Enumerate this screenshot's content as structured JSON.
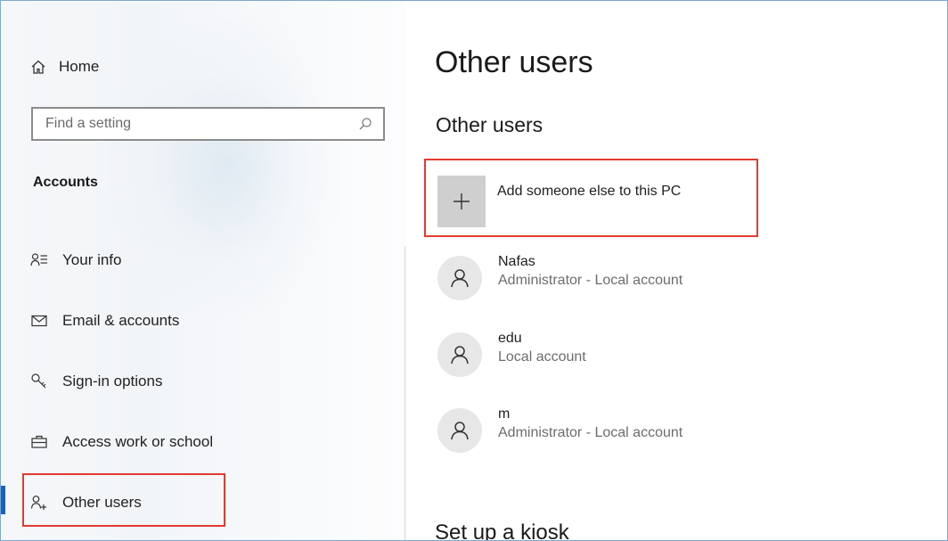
{
  "sidebar": {
    "home_label": "Home",
    "search": {
      "placeholder": "Find a setting",
      "value": ""
    },
    "section_title": "Accounts",
    "items": [
      {
        "label": "Your info",
        "icon": "your-info-icon"
      },
      {
        "label": "Email & accounts",
        "icon": "mail-icon"
      },
      {
        "label": "Sign-in options",
        "icon": "key-icon"
      },
      {
        "label": "Access work or school",
        "icon": "briefcase-icon"
      },
      {
        "label": "Other users",
        "icon": "add-person-icon",
        "selected": true
      }
    ]
  },
  "main": {
    "title": "Other users",
    "section_title": "Other users",
    "add_user_label": "Add someone else to this PC",
    "users": [
      {
        "name": "Nafas",
        "role": "Administrator - Local account"
      },
      {
        "name": "edu",
        "role": "Local account"
      },
      {
        "name": "m",
        "role": "Administrator - Local account"
      }
    ],
    "kiosk_title": "Set up a kiosk"
  },
  "colors": {
    "accent": "#1a62b7",
    "highlight_border": "#e23b2e",
    "plus_tile": "#cfcfcf",
    "avatar_bg": "#e7e7e7",
    "secondary_text": "#6d6d6d"
  }
}
